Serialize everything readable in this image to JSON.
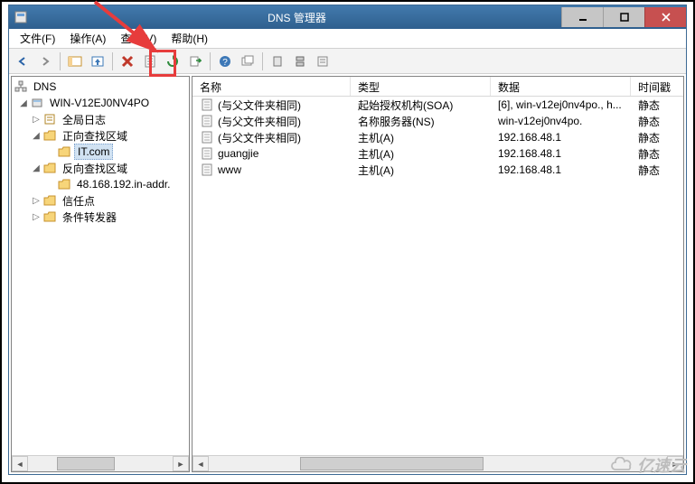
{
  "window": {
    "title": "DNS 管理器"
  },
  "menu": {
    "file": "文件(F)",
    "action": "操作(A)",
    "view": "查看(V)",
    "help": "帮助(H)"
  },
  "tree": {
    "root": "DNS",
    "server": "WIN-V12EJ0NV4PO",
    "global_log": "全局日志",
    "forward_zone": "正向查找区域",
    "zone_it": "IT.com",
    "reverse_zone": "反向查找区域",
    "zone_rev": "48.168.192.in-addr.",
    "trust_points": "信任点",
    "cond_forwarders": "条件转发器"
  },
  "columns": {
    "name": "名称",
    "type": "类型",
    "data": "数据",
    "timestamp": "时间戳"
  },
  "colwidths": {
    "name": 175,
    "type": 155,
    "data": 155,
    "timestamp": 55
  },
  "rows": [
    {
      "name": "(与父文件夹相同)",
      "type": "起始授权机构(SOA)",
      "data": "[6], win-v12ej0nv4po., h...",
      "ts": "静态"
    },
    {
      "name": "(与父文件夹相同)",
      "type": "名称服务器(NS)",
      "data": "win-v12ej0nv4po.",
      "ts": "静态"
    },
    {
      "name": "(与父文件夹相同)",
      "type": "主机(A)",
      "data": "192.168.48.1",
      "ts": "静态"
    },
    {
      "name": "guangjie",
      "type": "主机(A)",
      "data": "192.168.48.1",
      "ts": "静态"
    },
    {
      "name": "www",
      "type": "主机(A)",
      "data": "192.168.48.1",
      "ts": "静态"
    }
  ],
  "watermark": "亿速云"
}
